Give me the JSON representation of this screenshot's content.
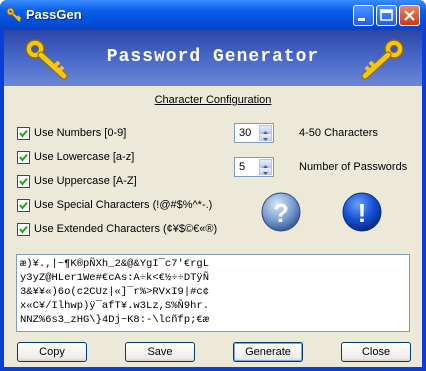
{
  "window": {
    "title": "PassGen"
  },
  "header": {
    "title": "Password Generator"
  },
  "config": {
    "section_label": "Character Configuration",
    "options": [
      {
        "label": "Use Numbers  [0-9]",
        "checked": true
      },
      {
        "label": "Use Lowercase  [a-z]",
        "checked": true
      },
      {
        "label": "Use Uppercase  [A-Z]",
        "checked": true
      },
      {
        "label": "Use Special Characters (!@#$%^*-.)",
        "checked": true
      },
      {
        "label": "Use Extended Characters (¢¥$©€«®)",
        "checked": true
      }
    ],
    "length": {
      "value": "30",
      "label": "4-50 Characters"
    },
    "count": {
      "value": "5",
      "label": "Number of Passwords"
    }
  },
  "output": {
    "lines": [
      "æ)¥.,|~¶K®pÑXh_2&@&YgI¯c7'€rgL",
      "y3yZ@HLer1We#€cAs:A÷k<€½÷÷DTÿÑ",
      "3&¥¥«)6o(c2CUz|«]¯r%>RVxI9|#c¢",
      "x«C¥/Ilhwp)ÿ¯afT¥.w3Lz,S%Ñ9hr.",
      "NNZ%6s3_zHG\\}4Dj~K8:-\\lcñfp;€æ"
    ]
  },
  "buttons": {
    "copy": "Copy",
    "save": "Save",
    "generate": "Generate",
    "close": "Close"
  },
  "icons": {
    "help": "question-icon",
    "info": "exclamation-icon",
    "key": "key-icon"
  }
}
